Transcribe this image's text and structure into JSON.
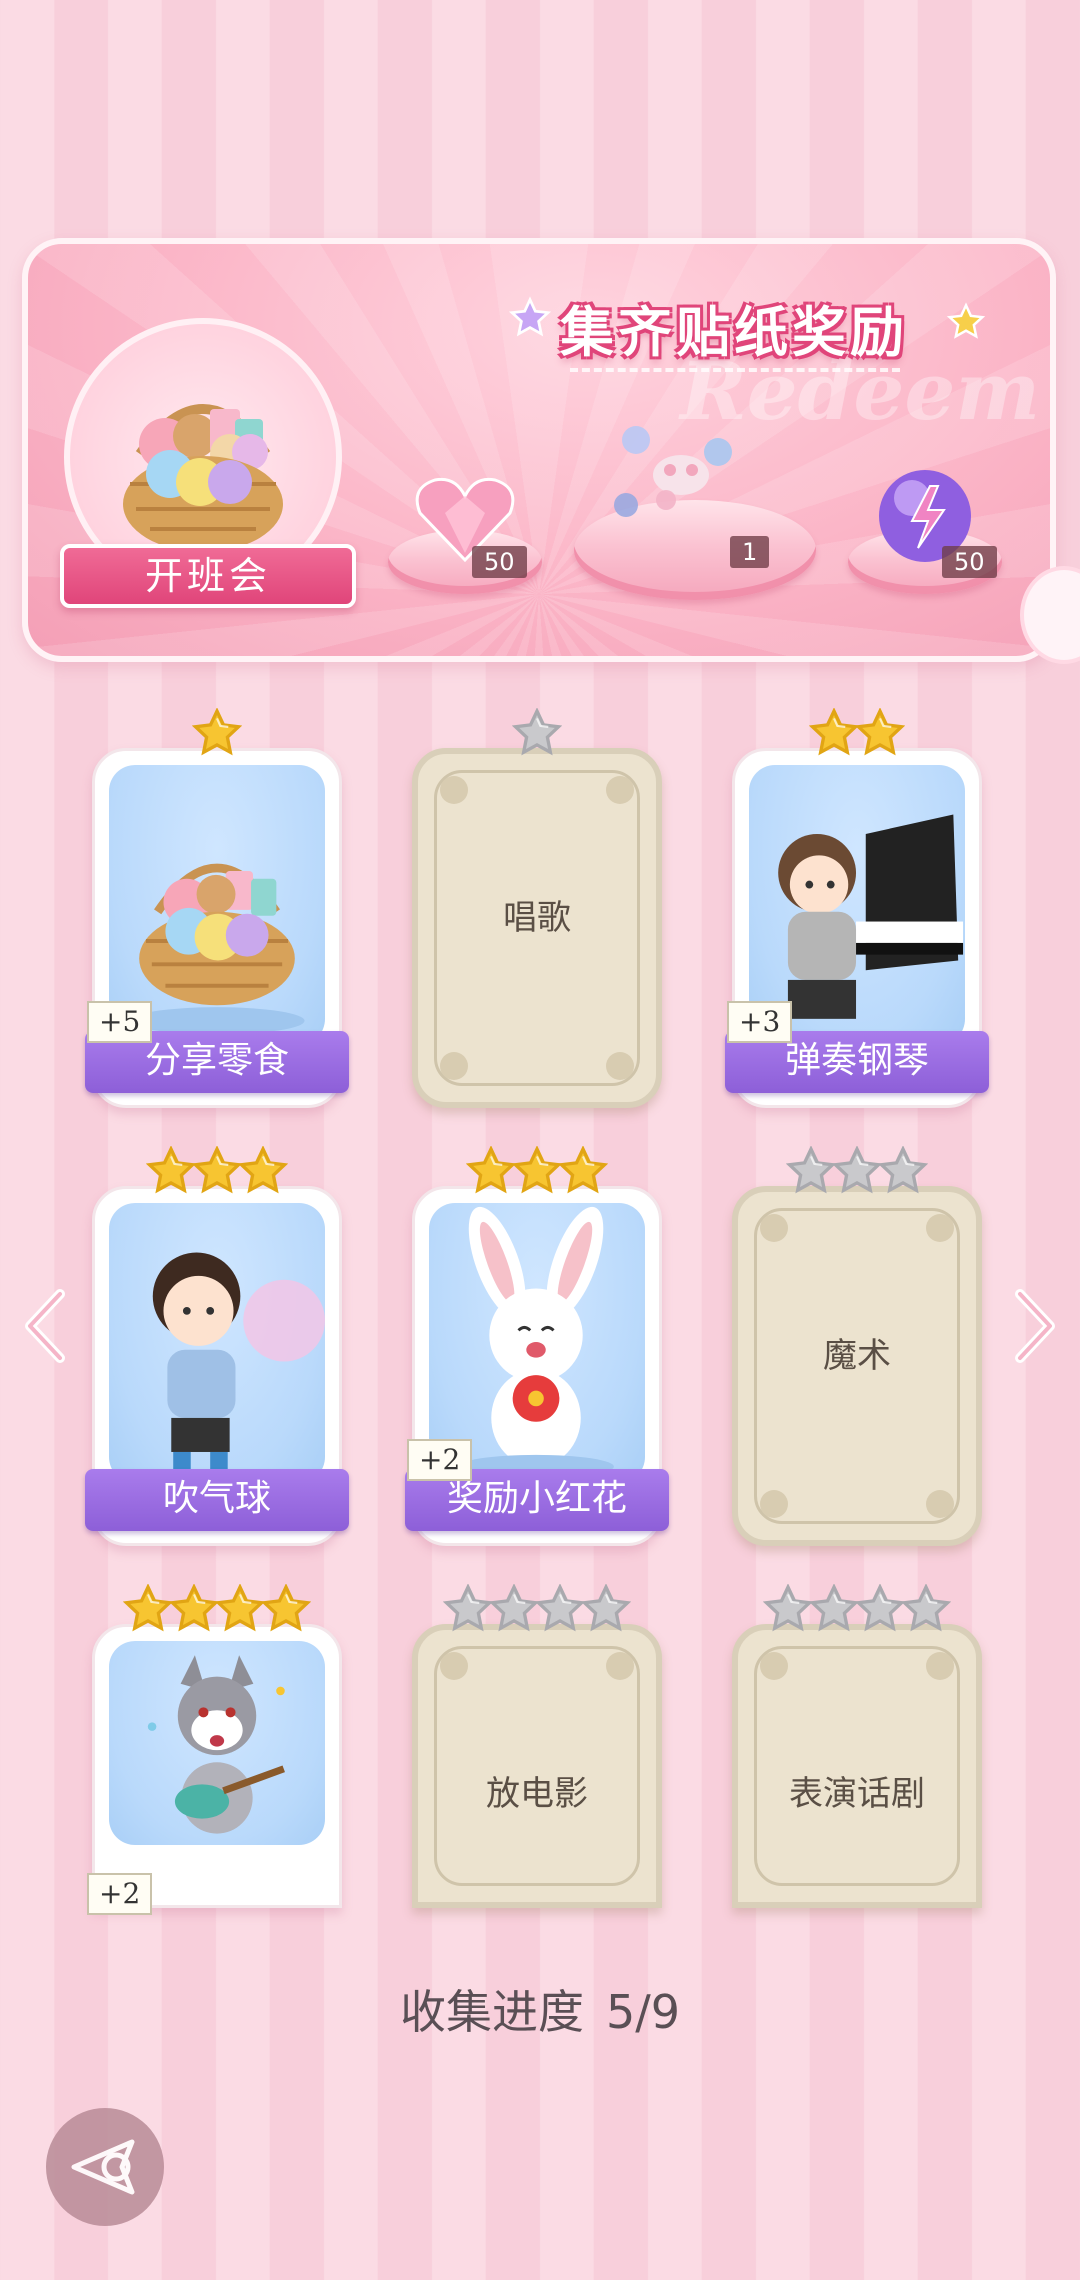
{
  "banner": {
    "title": "集齐贴纸奖励",
    "watermark": "Redeem",
    "event_label": "开班会",
    "rewards": [
      {
        "icon": "pink-heart-gem-icon",
        "count": "50"
      },
      {
        "icon": "bubble-toy-icon",
        "count": "1"
      },
      {
        "icon": "purple-energy-orb-icon",
        "count": "50"
      }
    ]
  },
  "cards": [
    {
      "name": "分享零食",
      "stars": 1,
      "unlocked": true,
      "bonus": "+5",
      "art": "snack-basket"
    },
    {
      "name": "唱歌",
      "stars": 1,
      "unlocked": false
    },
    {
      "name": "弹奏钢琴",
      "stars": 2,
      "unlocked": true,
      "bonus": "+3",
      "art": "boy-piano"
    },
    {
      "name": "吹气球",
      "stars": 3,
      "unlocked": true,
      "art": "boy-balloon"
    },
    {
      "name": "奖励小红花",
      "stars": 3,
      "unlocked": true,
      "bonus": "+2",
      "art": "bunny-flower"
    },
    {
      "name": "魔术",
      "stars": 3,
      "unlocked": false
    },
    {
      "name": "",
      "stars": 4,
      "unlocked": true,
      "bonus": "+2",
      "art": "wolf-guitar"
    },
    {
      "name": "放电影",
      "stars": 4,
      "unlocked": false
    },
    {
      "name": "表演话剧",
      "stars": 4,
      "unlocked": false
    }
  ],
  "progress": {
    "label": "收集进度",
    "value": "5/9"
  },
  "colors": {
    "gold_star": "#f7c531",
    "gray_star": "#c9c9cc",
    "ribbon": "#9a6be2",
    "accent_pink": "#e0457a"
  }
}
